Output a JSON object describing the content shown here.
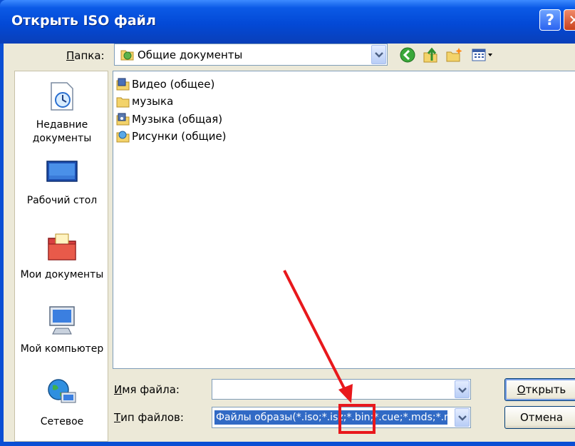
{
  "window": {
    "title": "Открыть ISO файл",
    "help_glyph": "?",
    "close_glyph": "✕"
  },
  "toolbar": {
    "lookin_label_u": "П",
    "lookin_label_rest": "апка:",
    "lookin_value": "Общие документы",
    "lookin_icon": "shared-folder-icon",
    "icons": [
      "back-icon",
      "up-folder-icon",
      "new-folder-icon",
      "view-menu-icon"
    ]
  },
  "places": [
    {
      "label": "Недавние документы",
      "icon": "recent-documents-icon"
    },
    {
      "label": "Рабочий стол",
      "icon": "desktop-icon"
    },
    {
      "label": "Мои документы",
      "icon": "my-documents-icon"
    },
    {
      "label": "Мой компьютер",
      "icon": "my-computer-icon"
    },
    {
      "label": "Сетевое",
      "icon": "network-icon"
    }
  ],
  "files": [
    {
      "name": "Видео (общее)",
      "icon": "video-folder-icon"
    },
    {
      "name": "музыка",
      "icon": "folder-icon"
    },
    {
      "name": "Музыка (общая)",
      "icon": "music-folder-icon"
    },
    {
      "name": "Рисунки (общие)",
      "icon": "pictures-folder-icon"
    }
  ],
  "filename": {
    "label_u": "И",
    "label_rest": "мя файла:",
    "value": ""
  },
  "filetype": {
    "label_u": "Т",
    "label_rest": "ип файлов:",
    "value": "Файлы образы(*.iso;*.isz;*.bin;*.cue;*.mds;*.mdf;*.nrg)"
  },
  "buttons": {
    "open_u": "О",
    "open_rest": "ткрыть",
    "cancel": "Отмена"
  },
  "colors": {
    "title_bar": "#0a4fd4",
    "selection": "#316ac5",
    "annotation": "#e8181c"
  }
}
